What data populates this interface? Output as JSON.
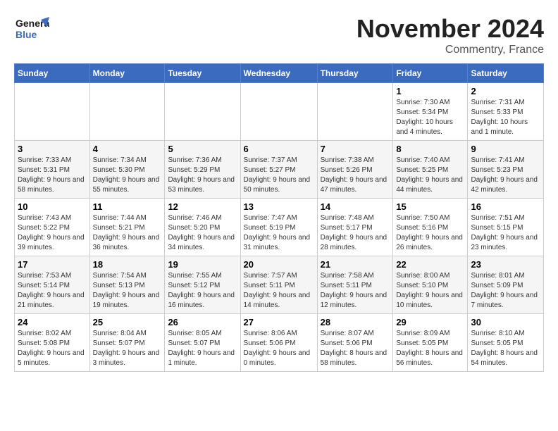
{
  "logo": {
    "line1": "General",
    "line2": "Blue"
  },
  "title": "November 2024",
  "location": "Commentry, France",
  "weekdays": [
    "Sunday",
    "Monday",
    "Tuesday",
    "Wednesday",
    "Thursday",
    "Friday",
    "Saturday"
  ],
  "weeks": [
    [
      {
        "day": "",
        "info": ""
      },
      {
        "day": "",
        "info": ""
      },
      {
        "day": "",
        "info": ""
      },
      {
        "day": "",
        "info": ""
      },
      {
        "day": "",
        "info": ""
      },
      {
        "day": "1",
        "info": "Sunrise: 7:30 AM\nSunset: 5:34 PM\nDaylight: 10 hours and 4 minutes."
      },
      {
        "day": "2",
        "info": "Sunrise: 7:31 AM\nSunset: 5:33 PM\nDaylight: 10 hours and 1 minute."
      }
    ],
    [
      {
        "day": "3",
        "info": "Sunrise: 7:33 AM\nSunset: 5:31 PM\nDaylight: 9 hours and 58 minutes."
      },
      {
        "day": "4",
        "info": "Sunrise: 7:34 AM\nSunset: 5:30 PM\nDaylight: 9 hours and 55 minutes."
      },
      {
        "day": "5",
        "info": "Sunrise: 7:36 AM\nSunset: 5:29 PM\nDaylight: 9 hours and 53 minutes."
      },
      {
        "day": "6",
        "info": "Sunrise: 7:37 AM\nSunset: 5:27 PM\nDaylight: 9 hours and 50 minutes."
      },
      {
        "day": "7",
        "info": "Sunrise: 7:38 AM\nSunset: 5:26 PM\nDaylight: 9 hours and 47 minutes."
      },
      {
        "day": "8",
        "info": "Sunrise: 7:40 AM\nSunset: 5:25 PM\nDaylight: 9 hours and 44 minutes."
      },
      {
        "day": "9",
        "info": "Sunrise: 7:41 AM\nSunset: 5:23 PM\nDaylight: 9 hours and 42 minutes."
      }
    ],
    [
      {
        "day": "10",
        "info": "Sunrise: 7:43 AM\nSunset: 5:22 PM\nDaylight: 9 hours and 39 minutes."
      },
      {
        "day": "11",
        "info": "Sunrise: 7:44 AM\nSunset: 5:21 PM\nDaylight: 9 hours and 36 minutes."
      },
      {
        "day": "12",
        "info": "Sunrise: 7:46 AM\nSunset: 5:20 PM\nDaylight: 9 hours and 34 minutes."
      },
      {
        "day": "13",
        "info": "Sunrise: 7:47 AM\nSunset: 5:19 PM\nDaylight: 9 hours and 31 minutes."
      },
      {
        "day": "14",
        "info": "Sunrise: 7:48 AM\nSunset: 5:17 PM\nDaylight: 9 hours and 28 minutes."
      },
      {
        "day": "15",
        "info": "Sunrise: 7:50 AM\nSunset: 5:16 PM\nDaylight: 9 hours and 26 minutes."
      },
      {
        "day": "16",
        "info": "Sunrise: 7:51 AM\nSunset: 5:15 PM\nDaylight: 9 hours and 23 minutes."
      }
    ],
    [
      {
        "day": "17",
        "info": "Sunrise: 7:53 AM\nSunset: 5:14 PM\nDaylight: 9 hours and 21 minutes."
      },
      {
        "day": "18",
        "info": "Sunrise: 7:54 AM\nSunset: 5:13 PM\nDaylight: 9 hours and 19 minutes."
      },
      {
        "day": "19",
        "info": "Sunrise: 7:55 AM\nSunset: 5:12 PM\nDaylight: 9 hours and 16 minutes."
      },
      {
        "day": "20",
        "info": "Sunrise: 7:57 AM\nSunset: 5:11 PM\nDaylight: 9 hours and 14 minutes."
      },
      {
        "day": "21",
        "info": "Sunrise: 7:58 AM\nSunset: 5:11 PM\nDaylight: 9 hours and 12 minutes."
      },
      {
        "day": "22",
        "info": "Sunrise: 8:00 AM\nSunset: 5:10 PM\nDaylight: 9 hours and 10 minutes."
      },
      {
        "day": "23",
        "info": "Sunrise: 8:01 AM\nSunset: 5:09 PM\nDaylight: 9 hours and 7 minutes."
      }
    ],
    [
      {
        "day": "24",
        "info": "Sunrise: 8:02 AM\nSunset: 5:08 PM\nDaylight: 9 hours and 5 minutes."
      },
      {
        "day": "25",
        "info": "Sunrise: 8:04 AM\nSunset: 5:07 PM\nDaylight: 9 hours and 3 minutes."
      },
      {
        "day": "26",
        "info": "Sunrise: 8:05 AM\nSunset: 5:07 PM\nDaylight: 9 hours and 1 minute."
      },
      {
        "day": "27",
        "info": "Sunrise: 8:06 AM\nSunset: 5:06 PM\nDaylight: 9 hours and 0 minutes."
      },
      {
        "day": "28",
        "info": "Sunrise: 8:07 AM\nSunset: 5:06 PM\nDaylight: 8 hours and 58 minutes."
      },
      {
        "day": "29",
        "info": "Sunrise: 8:09 AM\nSunset: 5:05 PM\nDaylight: 8 hours and 56 minutes."
      },
      {
        "day": "30",
        "info": "Sunrise: 8:10 AM\nSunset: 5:05 PM\nDaylight: 8 hours and 54 minutes."
      }
    ]
  ]
}
